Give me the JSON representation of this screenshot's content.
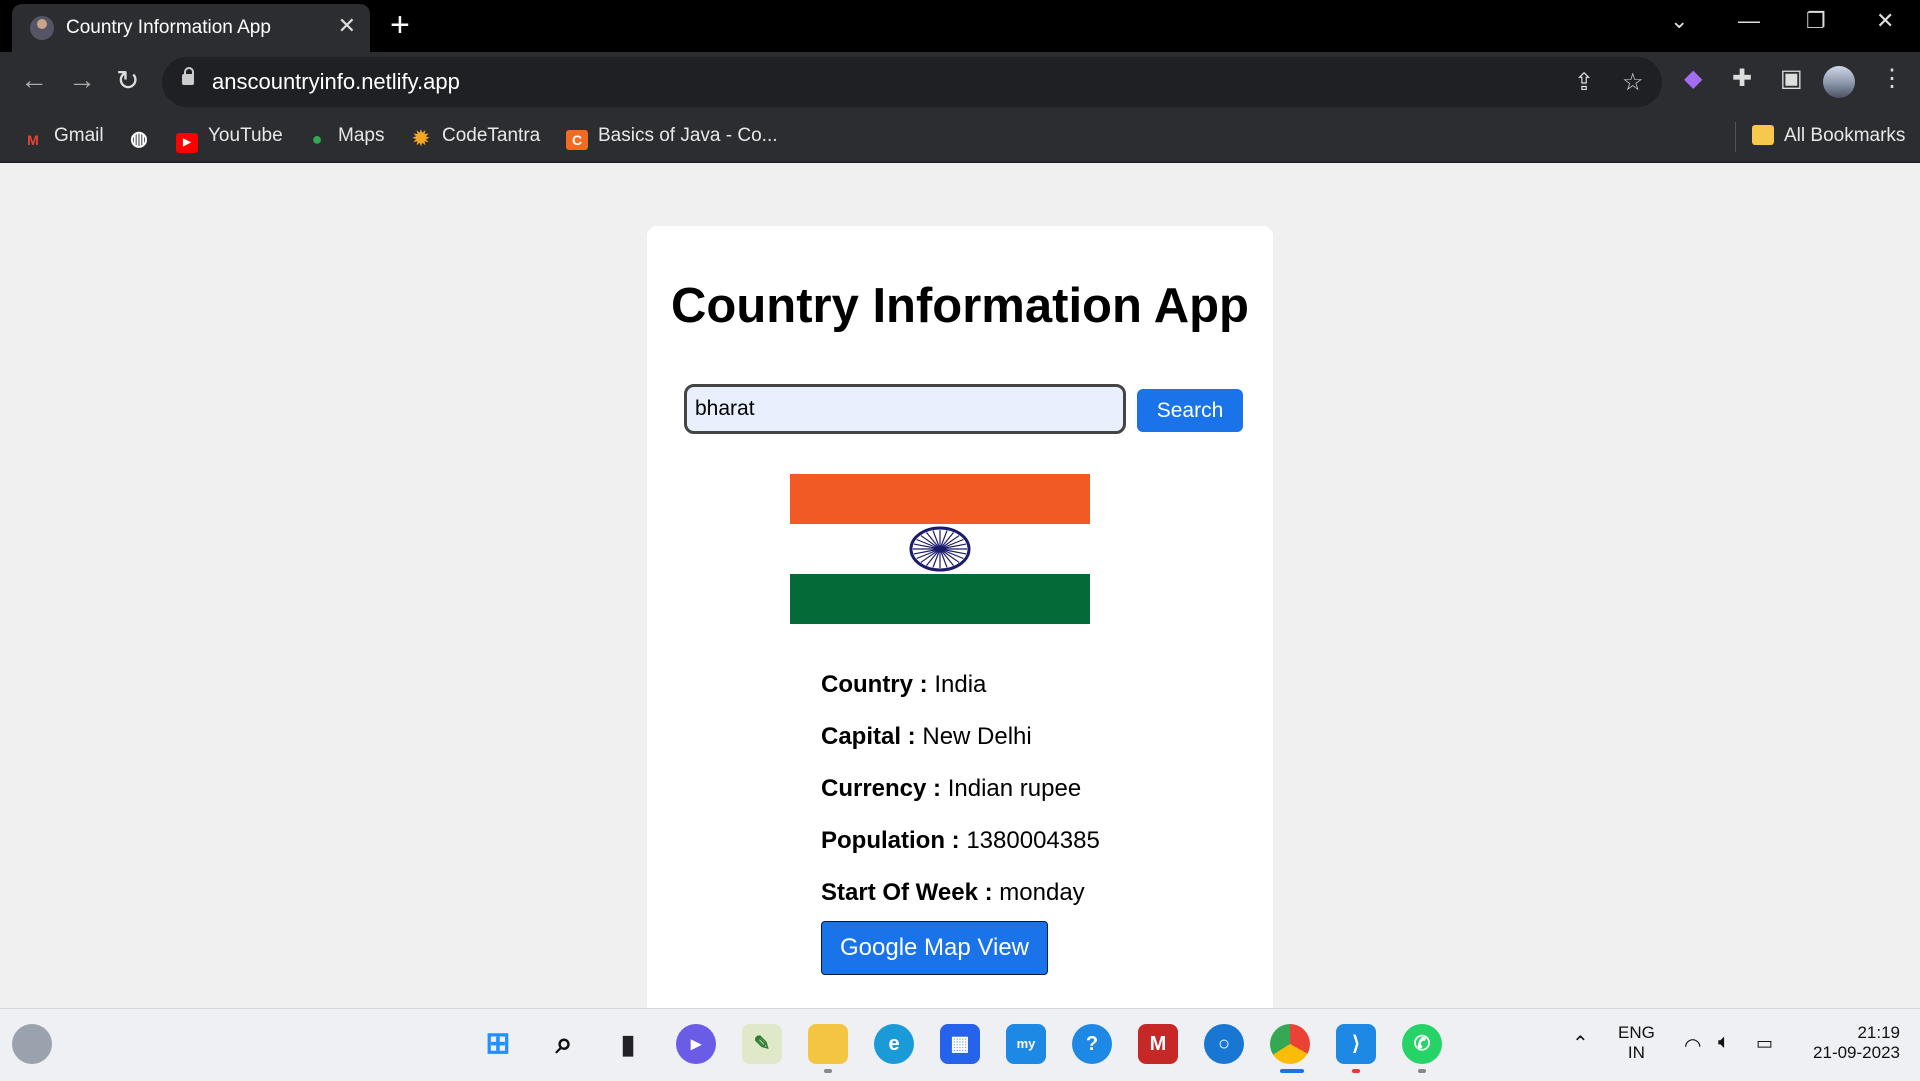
{
  "browser": {
    "tab_title": "Country Information App",
    "tab_close": "✕",
    "new_tab": "+",
    "url": "anscountryinfo.netlify.app",
    "bookmarks": [
      {
        "label": "Gmail",
        "icon": "gmail-icon"
      },
      {
        "label": "",
        "icon": "globe-icon"
      },
      {
        "label": "YouTube",
        "icon": "youtube-icon"
      },
      {
        "label": "Maps",
        "icon": "maps-icon"
      },
      {
        "label": "CodeTantra",
        "icon": "codetantra-icon"
      },
      {
        "label": "Basics of Java - Co...",
        "icon": "codechef-icon"
      }
    ],
    "all_bookmarks": "All Bookmarks"
  },
  "app": {
    "title": "Country Information App",
    "search": {
      "value": "bharat",
      "button_label": "Search"
    },
    "flag": {
      "top": "#f15a24",
      "middle": "#ffffff",
      "bottom": "#046a38",
      "wheel": "#1b1b6b"
    },
    "info": [
      {
        "label": "Country :",
        "value": "India"
      },
      {
        "label": "Capital :",
        "value": "New Delhi"
      },
      {
        "label": "Currency :",
        "value": "Indian rupee"
      },
      {
        "label": "Population :",
        "value": "1380004385"
      },
      {
        "label": "Start Of Week :",
        "value": "monday"
      }
    ],
    "map_button_label": "Google Map View"
  },
  "taskbar": {
    "lang_primary": "ENG",
    "lang_secondary": "IN",
    "time": "21:19",
    "date": "21-09-2023"
  },
  "colors": {
    "accent": "#1a73e8",
    "chrome_dark": "#2b2d31",
    "page_bg": "#f0f0f0"
  }
}
